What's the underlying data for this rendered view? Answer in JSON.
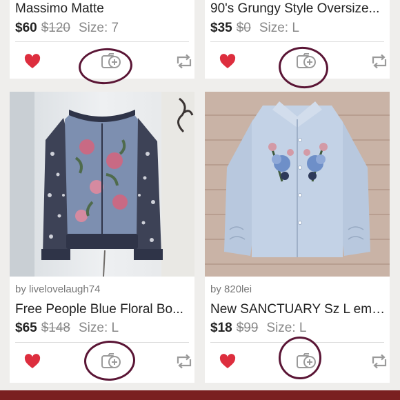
{
  "cards": [
    {
      "title": "Massimo Matte",
      "price": "$60",
      "original_price": "$120",
      "size": "Size: 7"
    },
    {
      "title": "90's Grungy Style Oversize...",
      "price": "$35",
      "original_price": "$0",
      "size": "Size: L"
    },
    {
      "seller": "by livelovelaugh74",
      "title": "Free People Blue Floral Bo...",
      "price": "$65",
      "original_price": "$148",
      "size": "Size: L"
    },
    {
      "seller": "by 820lei",
      "title": "New SANCTUARY Sz L emb...",
      "price": "$18",
      "original_price": "$99",
      "size": "Size: L"
    }
  ],
  "icons": {
    "like": "heart-icon",
    "bundle": "add-to-bundle-icon",
    "share": "share-icon"
  },
  "colors": {
    "heart": "#dd2e3e",
    "action_gray": "#9a9a9a",
    "annotation": "#5a1535"
  }
}
